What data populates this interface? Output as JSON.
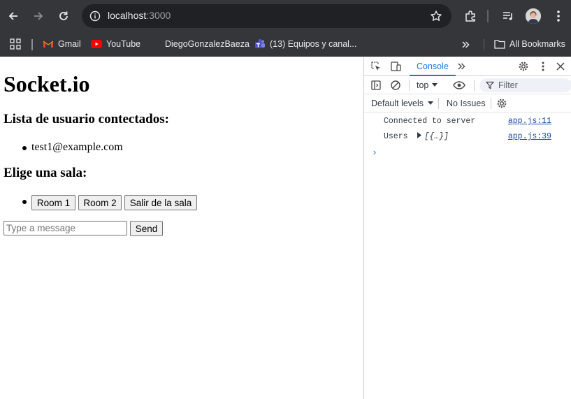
{
  "browser": {
    "url_host": "localhost",
    "url_port": ":3000",
    "icons": [
      "back-icon",
      "forward-icon",
      "reload-icon",
      "site-info-icon",
      "bookmark-star-icon",
      "extensions-icon",
      "media-icon",
      "profile-avatar",
      "menu-icon"
    ]
  },
  "bookmarks": {
    "items": [
      {
        "label": "Gmail",
        "icon": "gmail-icon"
      },
      {
        "label": "YouTube",
        "icon": "youtube-icon"
      },
      {
        "label": "DiegoGonzalezBaeza",
        "icon": "none"
      },
      {
        "label": "(13) Equipos y canal...",
        "icon": "teams-icon"
      }
    ],
    "all_bookmarks": "All Bookmarks"
  },
  "page": {
    "title": "Socket.io",
    "users_heading": "Lista de usuario contectados:",
    "users": [
      "test1@example.com"
    ],
    "rooms_heading": "Elige una sala:",
    "room1": "Room 1",
    "room2": "Room 2",
    "leave": "Salir de la sala",
    "message_placeholder": "Type a message",
    "send": "Send"
  },
  "devtools": {
    "tab_console": "Console",
    "context": "top",
    "filter_placeholder": "Filter",
    "levels": "Default levels",
    "issues": "No Issues",
    "logs": [
      {
        "message": "Connected to server",
        "source": "app.js:11"
      },
      {
        "message": "Users",
        "object": "[{…}]",
        "source": "app.js:39"
      }
    ],
    "prompt": "›"
  },
  "colors": {
    "chrome_bg": "#35363a",
    "omnibox_bg": "#202124",
    "accent": "#1a73e8"
  }
}
